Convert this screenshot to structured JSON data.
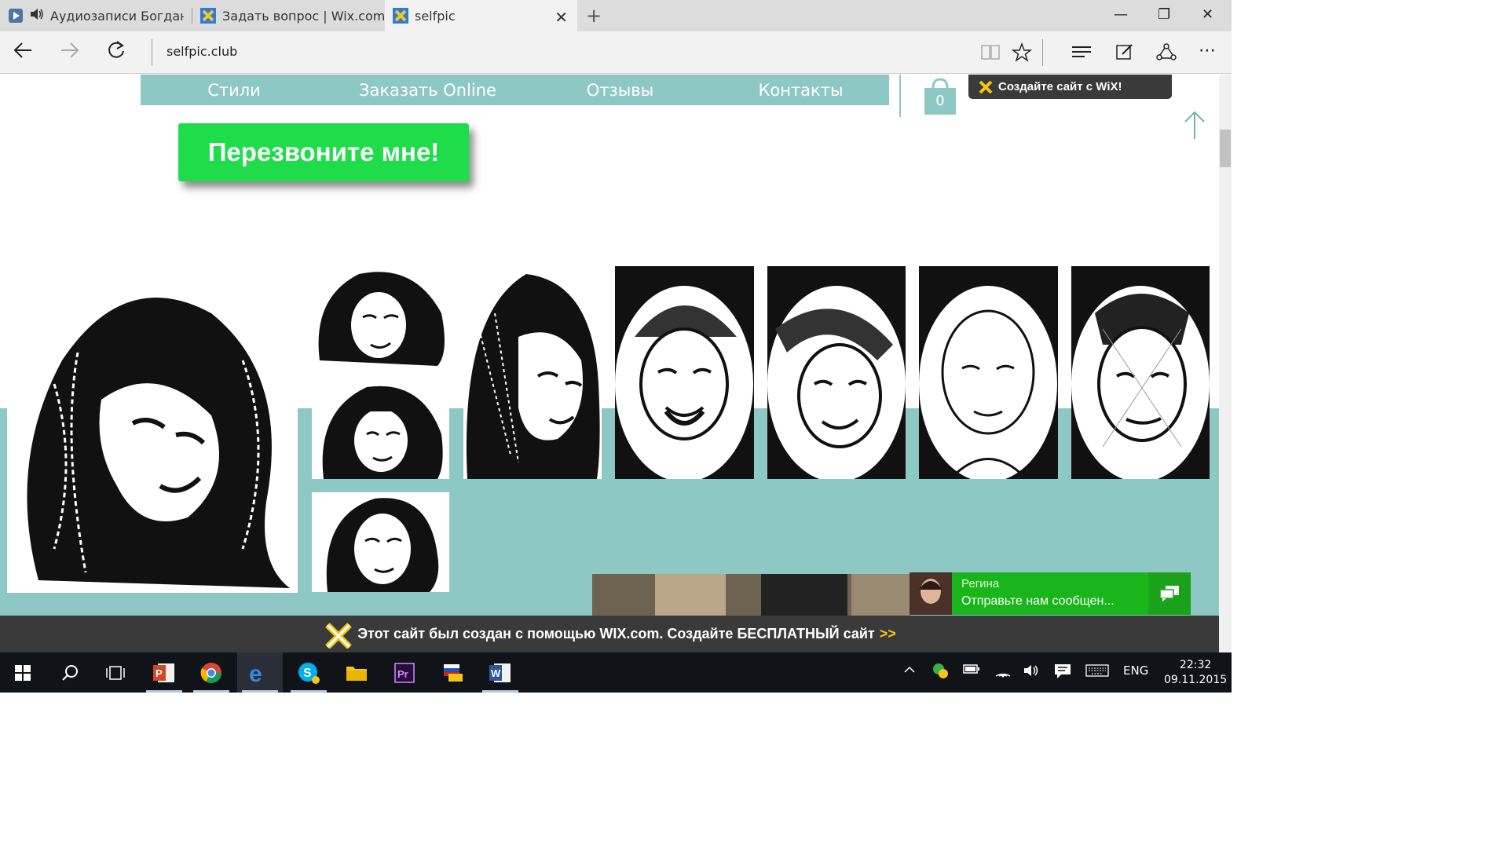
{
  "browser": {
    "tabs": [
      {
        "title": "Аудиозаписи Богдана Г",
        "active": false
      },
      {
        "title": "Задать вопрос | Wix.com",
        "active": false
      },
      {
        "title": "selfpic",
        "active": true
      }
    ],
    "url": "selfpic.club"
  },
  "site": {
    "menu": [
      "Стили",
      "Заказать Online",
      "Отзывы",
      "Контакты"
    ],
    "call_button": "Перезвоните мне!",
    "cart_count": "0",
    "wix_badge": "Создайте сайт с WiX!",
    "chat": {
      "name": "Регина",
      "message": "Отправьте нам сообщен..."
    },
    "footer_text": "Этот сайт был создан с помощью WIX.com. Создайте БЕСПЛАТНЫЙ сайт",
    "footer_arrows": ">>"
  },
  "taskbar": {
    "lang": "ENG",
    "time": "22:32",
    "date": "09.11.2015"
  },
  "colors": {
    "accent_teal": "#8ec8c5",
    "call_green": "#1fdc4a",
    "chat_green": "#1ab51a"
  }
}
